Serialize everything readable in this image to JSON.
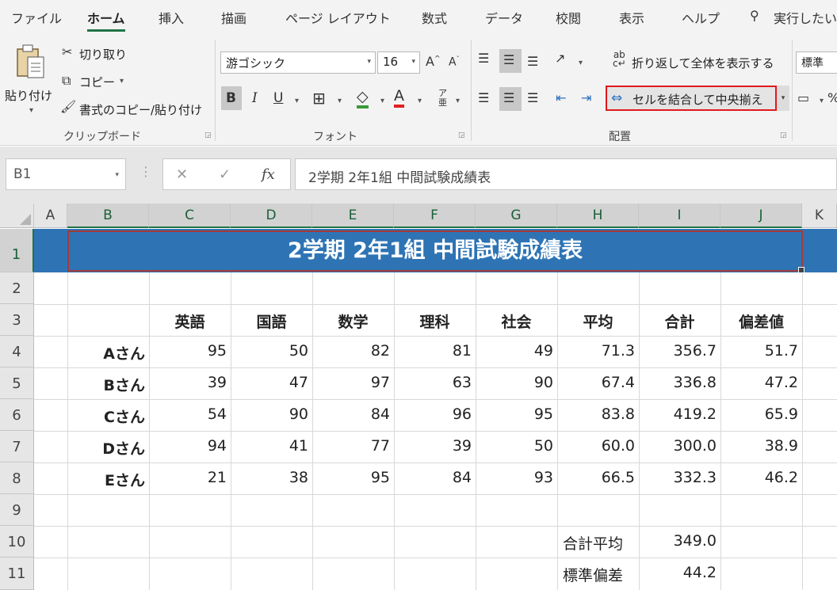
{
  "menu": {
    "tabs": [
      "ファイル",
      "ホーム",
      "挿入",
      "描画",
      "ページ レイアウト",
      "数式",
      "データ",
      "校閲",
      "表示",
      "ヘルプ"
    ],
    "active": "ホーム",
    "search": "実行したい"
  },
  "ribbon": {
    "clipboard": {
      "paste": "貼り付け",
      "cut": "切り取り",
      "copy": "コピー",
      "format_painter": "書式のコピー/貼り付け",
      "label": "クリップボード"
    },
    "font": {
      "name": "游ゴシック",
      "size": "16",
      "bold": "B",
      "italic": "I",
      "underline": "U",
      "label": "フォント"
    },
    "alignment": {
      "wrap_text": "折り返して全体を表示する",
      "merge_center": "セルを結合して中央揃え",
      "label": "配置"
    },
    "number": {
      "format": "標準"
    }
  },
  "formula_bar": {
    "name_box": "B1",
    "cancel": "✕",
    "enter": "✓",
    "fx": "fx",
    "content": "2学期 2年1組 中間試験成績表"
  },
  "sheet": {
    "columns": [
      "A",
      "B",
      "C",
      "D",
      "E",
      "F",
      "G",
      "H",
      "I",
      "J",
      "K"
    ],
    "rows": [
      "1",
      "2",
      "3",
      "4",
      "5",
      "6",
      "7",
      "8",
      "9",
      "10",
      "11"
    ],
    "title": "2学期 2年1組 中間試験成績表",
    "headers": [
      "英語",
      "国語",
      "数学",
      "理科",
      "社会",
      "平均",
      "合計",
      "偏差値"
    ],
    "students": [
      {
        "name": "Aさん",
        "scores": [
          "95",
          "50",
          "82",
          "81",
          "49",
          "71.3",
          "356.7",
          "51.7"
        ]
      },
      {
        "name": "Bさん",
        "scores": [
          "39",
          "47",
          "97",
          "63",
          "90",
          "67.4",
          "336.8",
          "47.2"
        ]
      },
      {
        "name": "Cさん",
        "scores": [
          "54",
          "90",
          "84",
          "96",
          "95",
          "83.8",
          "419.2",
          "65.9"
        ]
      },
      {
        "name": "Dさん",
        "scores": [
          "94",
          "41",
          "77",
          "39",
          "50",
          "60.0",
          "300.0",
          "38.9"
        ]
      },
      {
        "name": "Eさん",
        "scores": [
          "21",
          "38",
          "95",
          "84",
          "93",
          "66.5",
          "332.3",
          "46.2"
        ]
      }
    ],
    "summary": [
      {
        "label": "合計平均",
        "value": "349.0"
      },
      {
        "label": "標準偏差",
        "value": "44.2"
      }
    ]
  },
  "colors": {
    "title_fill": "#2e74b5",
    "accent": "#217346",
    "highlight_border": "#e0191b"
  }
}
